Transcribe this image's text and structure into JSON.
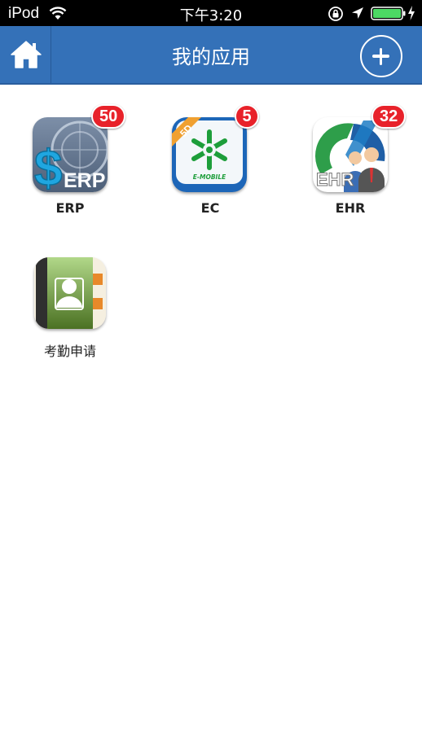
{
  "status_bar": {
    "carrier": "iPod",
    "time": "下午3:20"
  },
  "nav": {
    "title": "我的应用",
    "home_icon": "home-icon",
    "add_icon": "plus-icon"
  },
  "apps": [
    {
      "label": "ERP",
      "badge": "50",
      "icon": "erp-app-icon",
      "icon_text": "ERP"
    },
    {
      "label": "EC",
      "badge": "5",
      "icon": "ec-app-icon",
      "icon_text": "E-MOBILE",
      "ribbon": "5D"
    },
    {
      "label": "EHR",
      "badge": "32",
      "icon": "ehr-app-icon",
      "icon_text": "EHR"
    },
    {
      "label": "考勤申请",
      "badge": null,
      "icon": "attendance-app-icon"
    }
  ],
  "colors": {
    "nav_bg": "#3471b8",
    "badge_red": "#e8222a"
  }
}
